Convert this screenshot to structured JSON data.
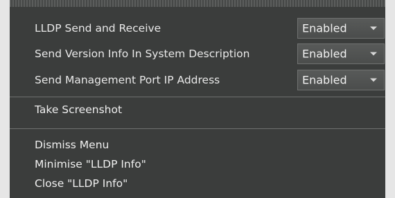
{
  "menu": {
    "settings": [
      {
        "label": "LLDP Send and Receive",
        "value": "Enabled"
      },
      {
        "label": "Send Version Info In System Description",
        "value": "Enabled"
      },
      {
        "label": "Send Management Port IP Address",
        "value": "Enabled"
      }
    ],
    "actions": {
      "screenshot": "Take Screenshot",
      "dismiss": "Dismiss Menu",
      "minimise": "Minimise \"LLDP Info\"",
      "close": "Close \"LLDP Info\""
    }
  },
  "icons": {
    "dropdown": "chevron-down-icon"
  },
  "colors": {
    "menu_background": "#3b3d3c",
    "text": "#e9e9e9",
    "dropdown_background": "#545655",
    "divider": "#6f7170"
  }
}
